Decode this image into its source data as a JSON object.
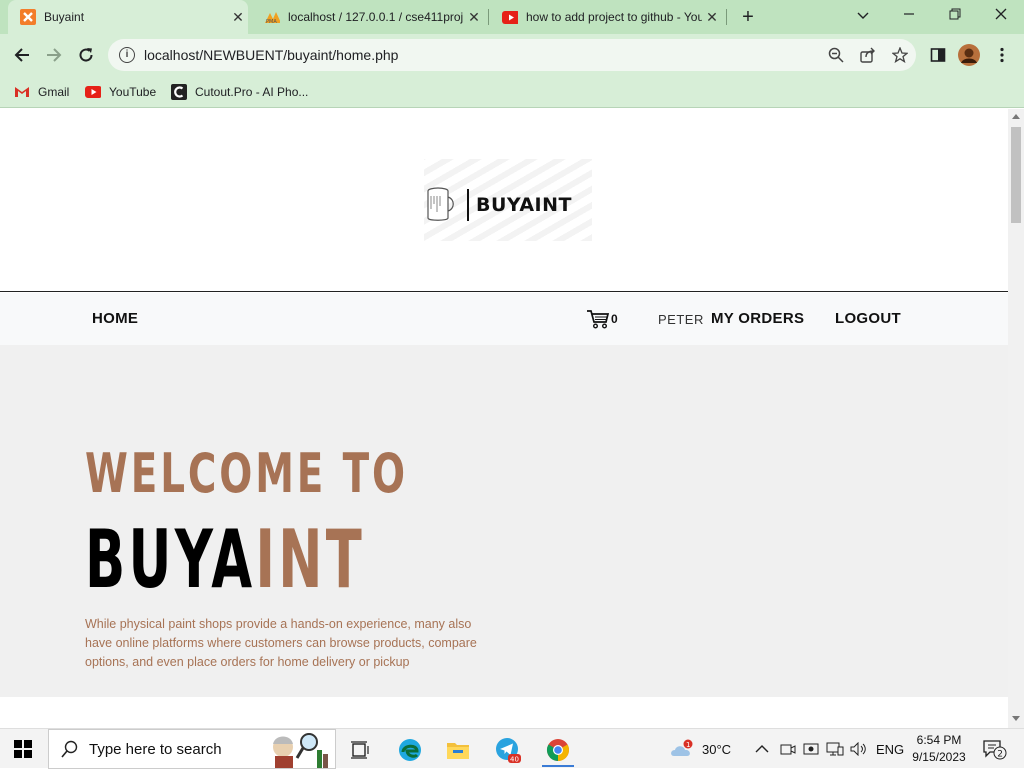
{
  "browser": {
    "tabs": [
      {
        "title": "Buyaint",
        "active": true
      },
      {
        "title": "localhost / 127.0.0.1 / cse411proj",
        "active": false
      },
      {
        "title": "how to add project to github - You",
        "active": false
      }
    ],
    "url": "localhost/NEWBUENT/buyaint/home.php",
    "bookmarks": [
      {
        "label": "Gmail",
        "icon": "gmail-icon"
      },
      {
        "label": "YouTube",
        "icon": "youtube-icon"
      },
      {
        "label": "Cutout.Pro - AI Pho...",
        "icon": "cutout-icon"
      }
    ]
  },
  "site": {
    "logo_text": "BUYAINT",
    "nav": {
      "home": "HOME",
      "cart_count": "0",
      "username": "PETER",
      "my_orders": "MY ORDERS",
      "logout": "LOGOUT"
    },
    "hero": {
      "welcome": "WELCOME TO",
      "brand_part1": "BUYA",
      "brand_part2": "INT",
      "description": "While physical paint shops provide a hands-on experience, many also have online platforms where customers can browse products, compare options, and even place orders for home delivery or pickup"
    },
    "colors": {
      "accent": "#a77355",
      "nav_bg": "#f8f9fa",
      "hero_bg": "#f0f0f0"
    }
  },
  "taskbar": {
    "search_placeholder": "Type here to search",
    "weather_temp": "30°C",
    "weather_badge": "1",
    "telegram_badge": "40",
    "language": "ENG",
    "time": "6:54 PM",
    "date": "9/15/2023",
    "notifications": "2"
  }
}
